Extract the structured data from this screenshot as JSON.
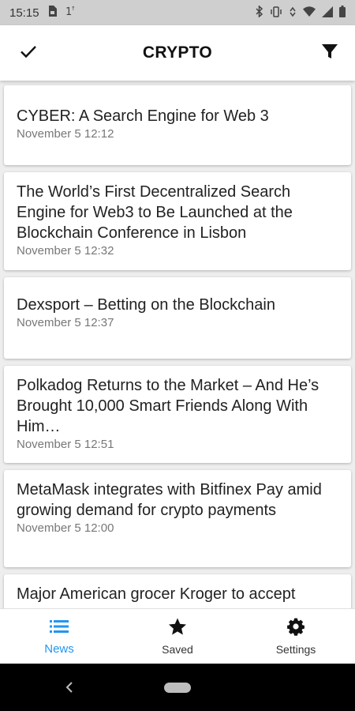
{
  "status_bar": {
    "time": "15:15",
    "left_icons": [
      "sim-card-icon",
      "signal-1-icon"
    ],
    "right_icons": [
      "bluetooth-icon",
      "vibrate-icon",
      "data-icon",
      "wifi-icon",
      "cell-signal-icon",
      "battery-icon"
    ]
  },
  "app_bar": {
    "title": "CRYPTO",
    "left_action": "check-icon",
    "right_action": "filter-icon"
  },
  "articles": [
    {
      "title": "CYBER: A Search Engine for Web 3",
      "date": "November 5 12:12"
    },
    {
      "title": "The World’s First Decentralized Search Engine for Web3 to Be Launched at the Blockchain Conference in Lisbon",
      "date": "November 5 12:32"
    },
    {
      "title": "Dexsport – Betting on the Blockchain",
      "date": "November 5 12:37"
    },
    {
      "title": "Polkadog Returns to the Market – And He’s Brought 10,000 Smart Friends Along With Him…",
      "date": "November 5 12:51"
    },
    {
      "title": "MetaMask integrates with Bitfinex Pay amid growing demand for crypto payments",
      "date": "November 5 12:00"
    },
    {
      "title": "Major American grocer Kroger to accept",
      "date": ""
    }
  ],
  "bottom_nav": {
    "items": [
      {
        "label": "News",
        "icon": "list-icon",
        "active": true
      },
      {
        "label": "Saved",
        "icon": "star-icon",
        "active": false
      },
      {
        "label": "Settings",
        "icon": "gear-icon",
        "active": false
      }
    ]
  },
  "colors": {
    "accent": "#2196f3",
    "status_bar": "#cfcfcf",
    "background": "#eeeeee"
  }
}
